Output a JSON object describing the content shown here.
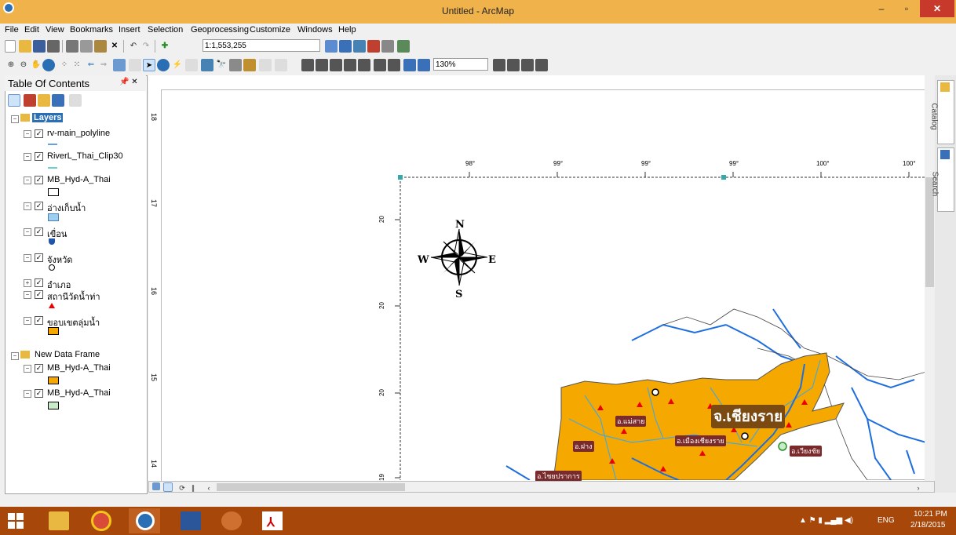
{
  "window": {
    "title": "Untitled - ArcMap",
    "minimize": "–",
    "maximize": "▫",
    "close": "✕"
  },
  "menu": [
    "File",
    "Edit",
    "View",
    "Bookmarks",
    "Insert",
    "Selection",
    "Geoprocessing",
    "Customize",
    "Windows",
    "Help"
  ],
  "toolbar": {
    "scale": "1:1,553,255",
    "zoom": "130%"
  },
  "toc": {
    "title": "Table Of Contents",
    "pin": "📌 ✕",
    "frames": [
      {
        "name": "Layers",
        "layers": [
          "rv-main_polyline",
          "RiverL_Thai_Clip30",
          "MB_Hyd-A_Thai",
          "อ่างเก็บน้ำ",
          "เขื่อน",
          "จังหวัด",
          "อำเภอ",
          "สถานีวัดน้ำท่า",
          "ขอบเขตลุ่มน้ำ"
        ]
      },
      {
        "name": "New Data Frame",
        "layers": [
          "MB_Hyd-A_Thai",
          "MB_Hyd-A_Thai"
        ]
      }
    ]
  },
  "map": {
    "lon_ticks": [
      "98°",
      "99°",
      "99°",
      "99°",
      "100°",
      "100°"
    ],
    "lat_ticks": [
      "20",
      "20",
      "20",
      "19"
    ],
    "ruler_v": [
      "18",
      "17",
      "16",
      "15",
      "14"
    ],
    "compass": {
      "n": "N",
      "s": "S",
      "e": "E",
      "w": "W"
    },
    "labels": {
      "province": "จ.เชียงราย",
      "d1": "อ.แม่สาย",
      "d2": "อ.เมืองเชียงราย",
      "d3": "อ.เวียงชัย",
      "d4": "อ.ฝาง",
      "d5": "อ.ไชยปราการ"
    }
  },
  "right_panel": {
    "catalog": "Catalog",
    "search": "Search"
  },
  "taskbar": {
    "lang": "ENG",
    "time": "10:21 PM",
    "date": "2/18/2015"
  },
  "colors": {
    "titlebar": "#f0b24a",
    "basin": "#f5a800",
    "river": "#1e6ee0",
    "taskbar": "#a8470a"
  }
}
